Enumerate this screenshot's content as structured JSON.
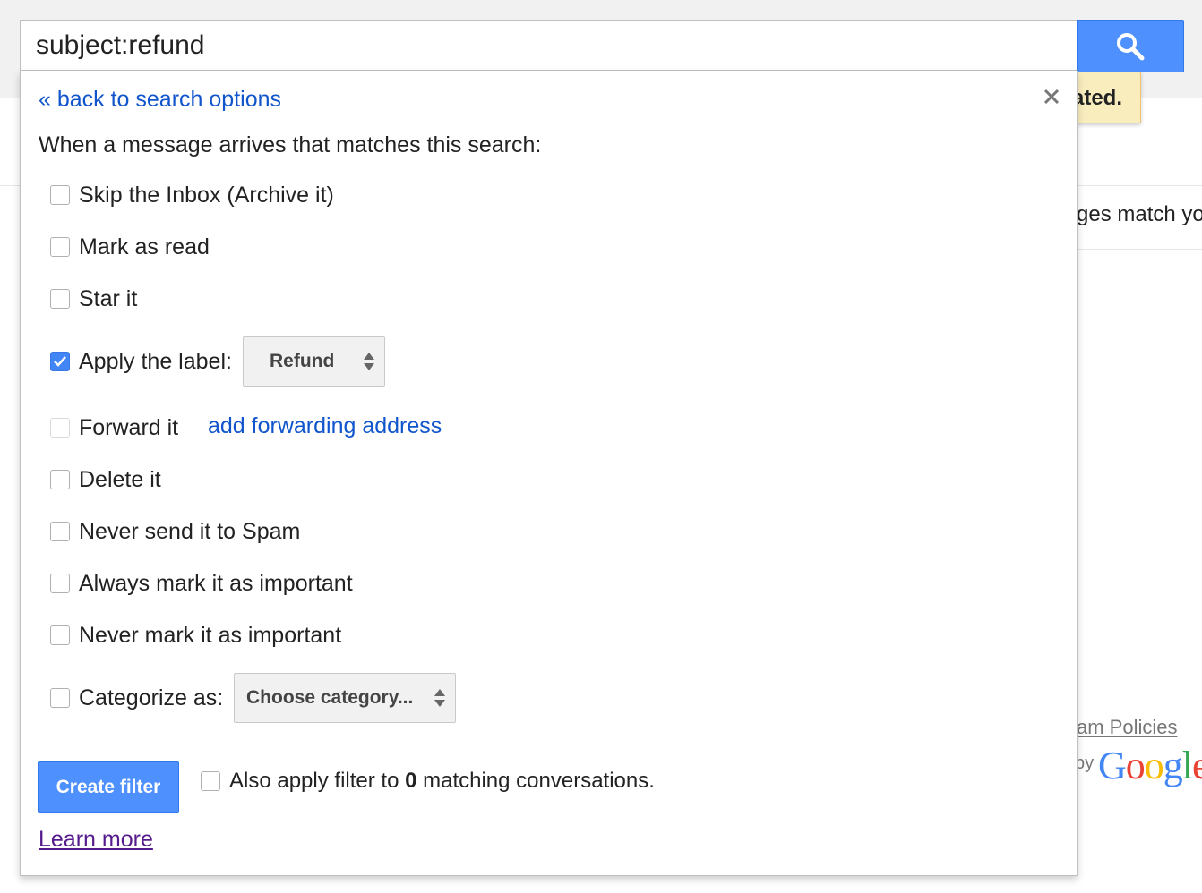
{
  "search": {
    "query": "subject:refund",
    "button_icon": "search-icon"
  },
  "background": {
    "toast_text": "ated.",
    "results_text": "ges match yo",
    "policies_link": "am Policies",
    "powered_by": "by",
    "logo_letters": [
      "G",
      "o",
      "o",
      "g",
      "l",
      "e"
    ]
  },
  "filter_panel": {
    "back_link": "« back to search options",
    "close_icon": "close-icon",
    "intro": "When a message arrives that matches this search:",
    "options": {
      "skip_inbox": {
        "label": "Skip the Inbox (Archive it)",
        "checked": false
      },
      "mark_read": {
        "label": "Mark as read",
        "checked": false
      },
      "star": {
        "label": "Star it",
        "checked": false
      },
      "apply_label": {
        "label": "Apply the label:",
        "checked": true,
        "selected_value": "Refund"
      },
      "forward": {
        "label": "Forward it",
        "checked": false,
        "disabled": true,
        "link": "add forwarding address"
      },
      "delete": {
        "label": "Delete it",
        "checked": false
      },
      "never_spam": {
        "label": "Never send it to Spam",
        "checked": false
      },
      "always_important": {
        "label": "Always mark it as important",
        "checked": false
      },
      "never_important": {
        "label": "Never mark it as important",
        "checked": false
      },
      "categorize": {
        "label": "Categorize as:",
        "checked": false,
        "selected_value": "Choose category..."
      }
    },
    "create_button": "Create filter",
    "also_apply": {
      "prefix": "Also apply filter to ",
      "count": "0",
      "suffix": " matching conversations.",
      "checked": false
    },
    "learn_more": "Learn more"
  },
  "colors": {
    "primary_blue": "#4d90fe",
    "link_blue": "#1155cc",
    "visited_link": "#551a8b",
    "toast_bg": "#f9edbe",
    "checkbox_checked": "#4285f4"
  }
}
